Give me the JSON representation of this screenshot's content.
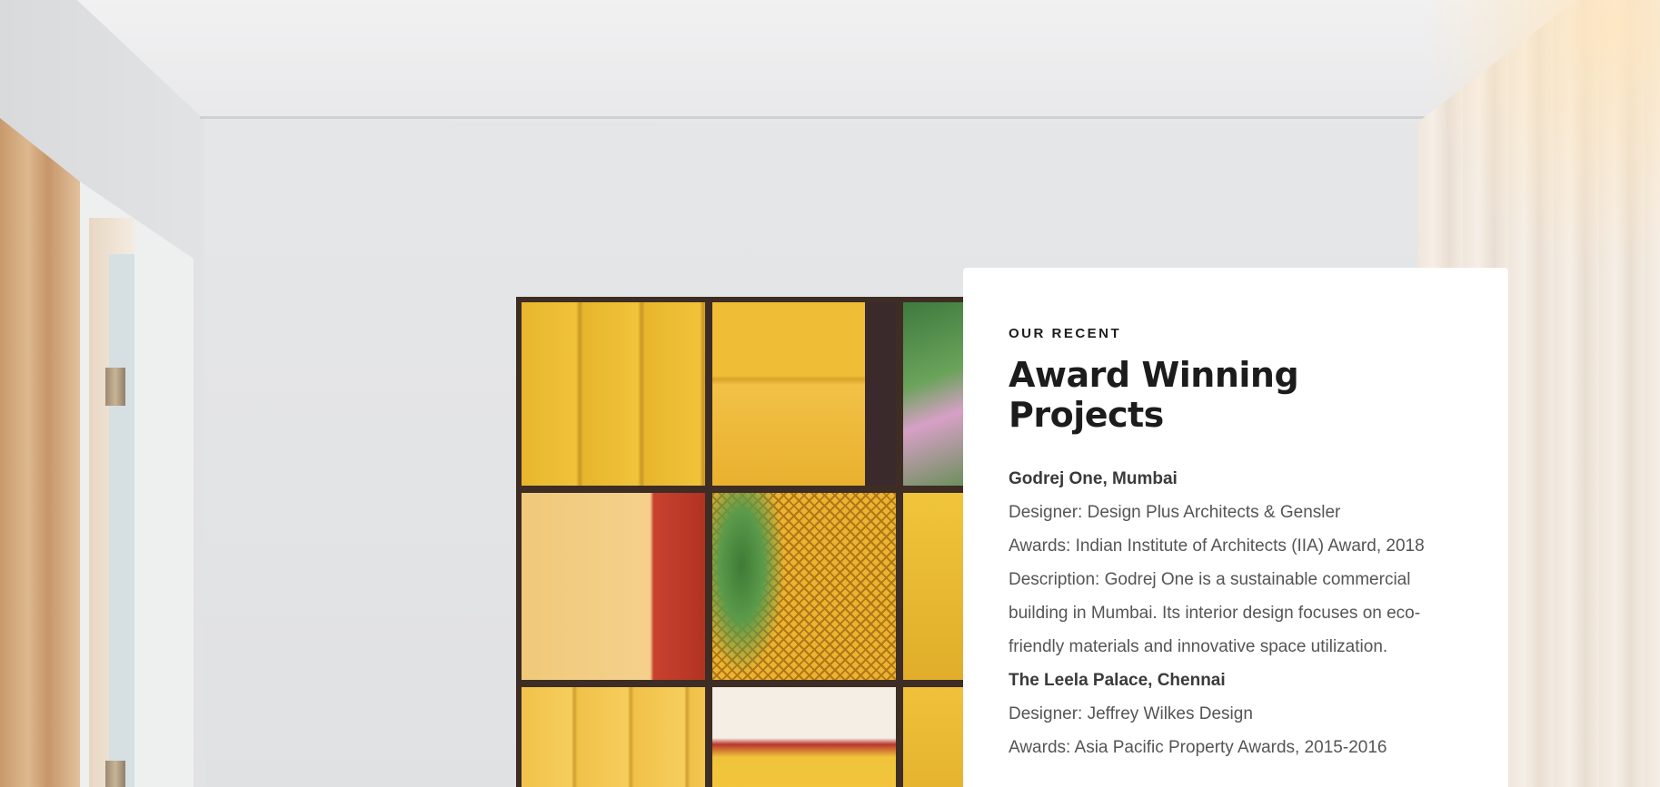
{
  "section": {
    "eyebrow": "OUR RECENT",
    "title": "Award Winning Projects"
  },
  "projects": [
    {
      "name": "Godrej One, Mumbai",
      "designer": "Designer: Design Plus Architects & Gensler",
      "awards": "Awards: Indian Institute of Architects (IIA) Award, 2018",
      "description": "Description: Godrej One is a sustainable commercial building in Mumbai. Its interior design focuses on eco-friendly materials and innovative space utilization."
    },
    {
      "name": "The Leela Palace, Chennai",
      "designer": "Designer: Jeffrey Wilkes Design",
      "awards": "Awards: Asia Pacific Property Awards, 2015-2016"
    }
  ],
  "colors": {
    "card_background": "#ffffff",
    "heading": "#1c1c1c",
    "body_text": "#555555"
  }
}
